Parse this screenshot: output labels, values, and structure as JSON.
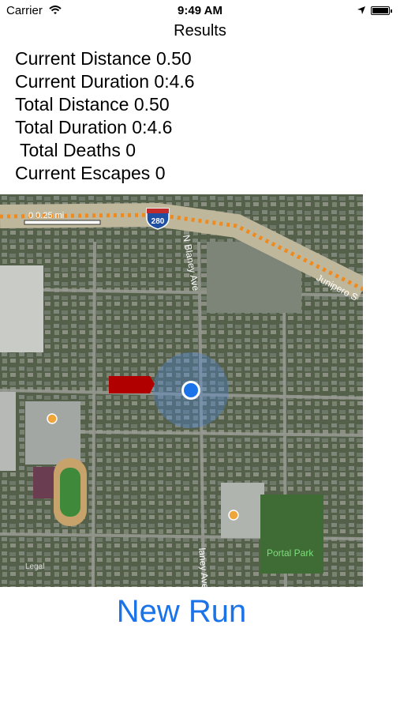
{
  "status": {
    "carrier": "Carrier",
    "time": "9:49 AM",
    "icons": [
      "wifi-icon",
      "location-arrow-icon",
      "battery-icon"
    ]
  },
  "nav": {
    "title": "Results"
  },
  "stats": [
    "Current Distance 0.50",
    "Current Duration 0:4.6",
    "Total Distance 0.50",
    "Total Duration 0:4.6",
    " Total Deaths 0",
    "Current Escapes 0"
  ],
  "map": {
    "scale_label": "0    0.25 mi",
    "shield_label": "280",
    "road_labels": [
      "N Blaney Ave",
      "Junipero S",
      "laney Ave"
    ],
    "park_label": "Portal Park",
    "corner_label": "Legal",
    "colors": {
      "flag": "#b00000",
      "user_dot": "#1a73e8",
      "route": "#ef8a1e"
    }
  },
  "actions": {
    "new_run": "New Run"
  }
}
